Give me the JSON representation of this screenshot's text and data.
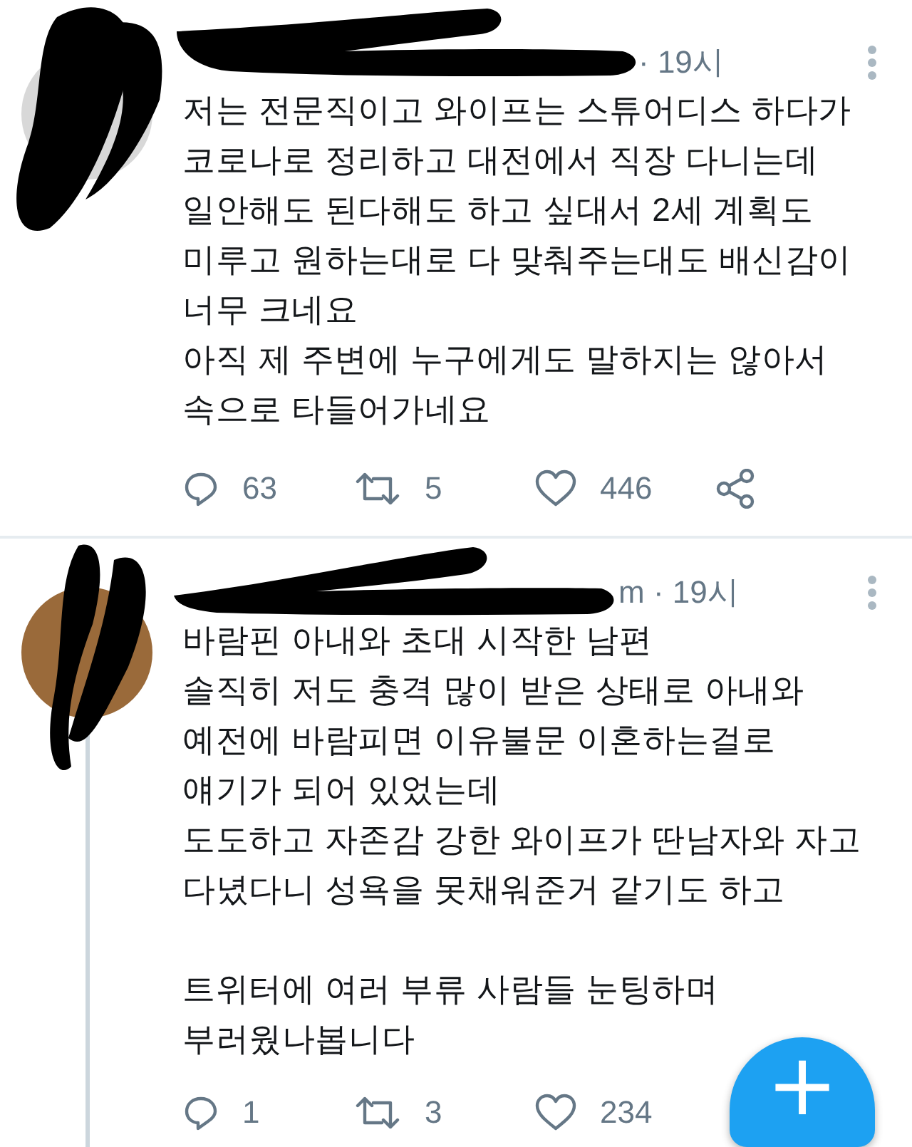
{
  "tweets": [
    {
      "meta": "· 19시",
      "text": "저는 전문직이고 와이프는 스튜어디스 하다가\n코로나로 정리하고 대전에서 직장 다니는데\n일안해도 된다해도 하고 싶대서 2세 계획도\n미루고 원하는대로 다 맞춰주는대도 배신감이\n너무 크네요\n아직 제 주변에 누구에게도 말하지는 않아서\n속으로 타들어가네요",
      "thread_line": false,
      "actions": [
        {
          "kind": "reply",
          "count": "63"
        },
        {
          "kind": "retweet",
          "count": "5"
        },
        {
          "kind": "like",
          "count": "446"
        },
        {
          "kind": "share"
        }
      ]
    },
    {
      "meta": "m · 19시",
      "text": "바람핀 아내와 초대 시작한 남편\n솔직히 저도 충격 많이 받은 상태로 아내와\n예전에 바람피면 이유불문 이혼하는걸로\n얘기가 되어 있었는데\n도도하고 자존감 강한 와이프가 딴남자와 자고\n다녔다니 성욕을 못채워준거 같기도 하고\n\n트위터에 여러 부류 사람들 눈팅하며\n부러웠나봅니다",
      "thread_line": true,
      "actions": [
        {
          "kind": "reply",
          "count": "1"
        },
        {
          "kind": "retweet",
          "count": "3"
        },
        {
          "kind": "like",
          "count": "234"
        }
      ]
    }
  ],
  "compose_button": {
    "label": "+"
  }
}
